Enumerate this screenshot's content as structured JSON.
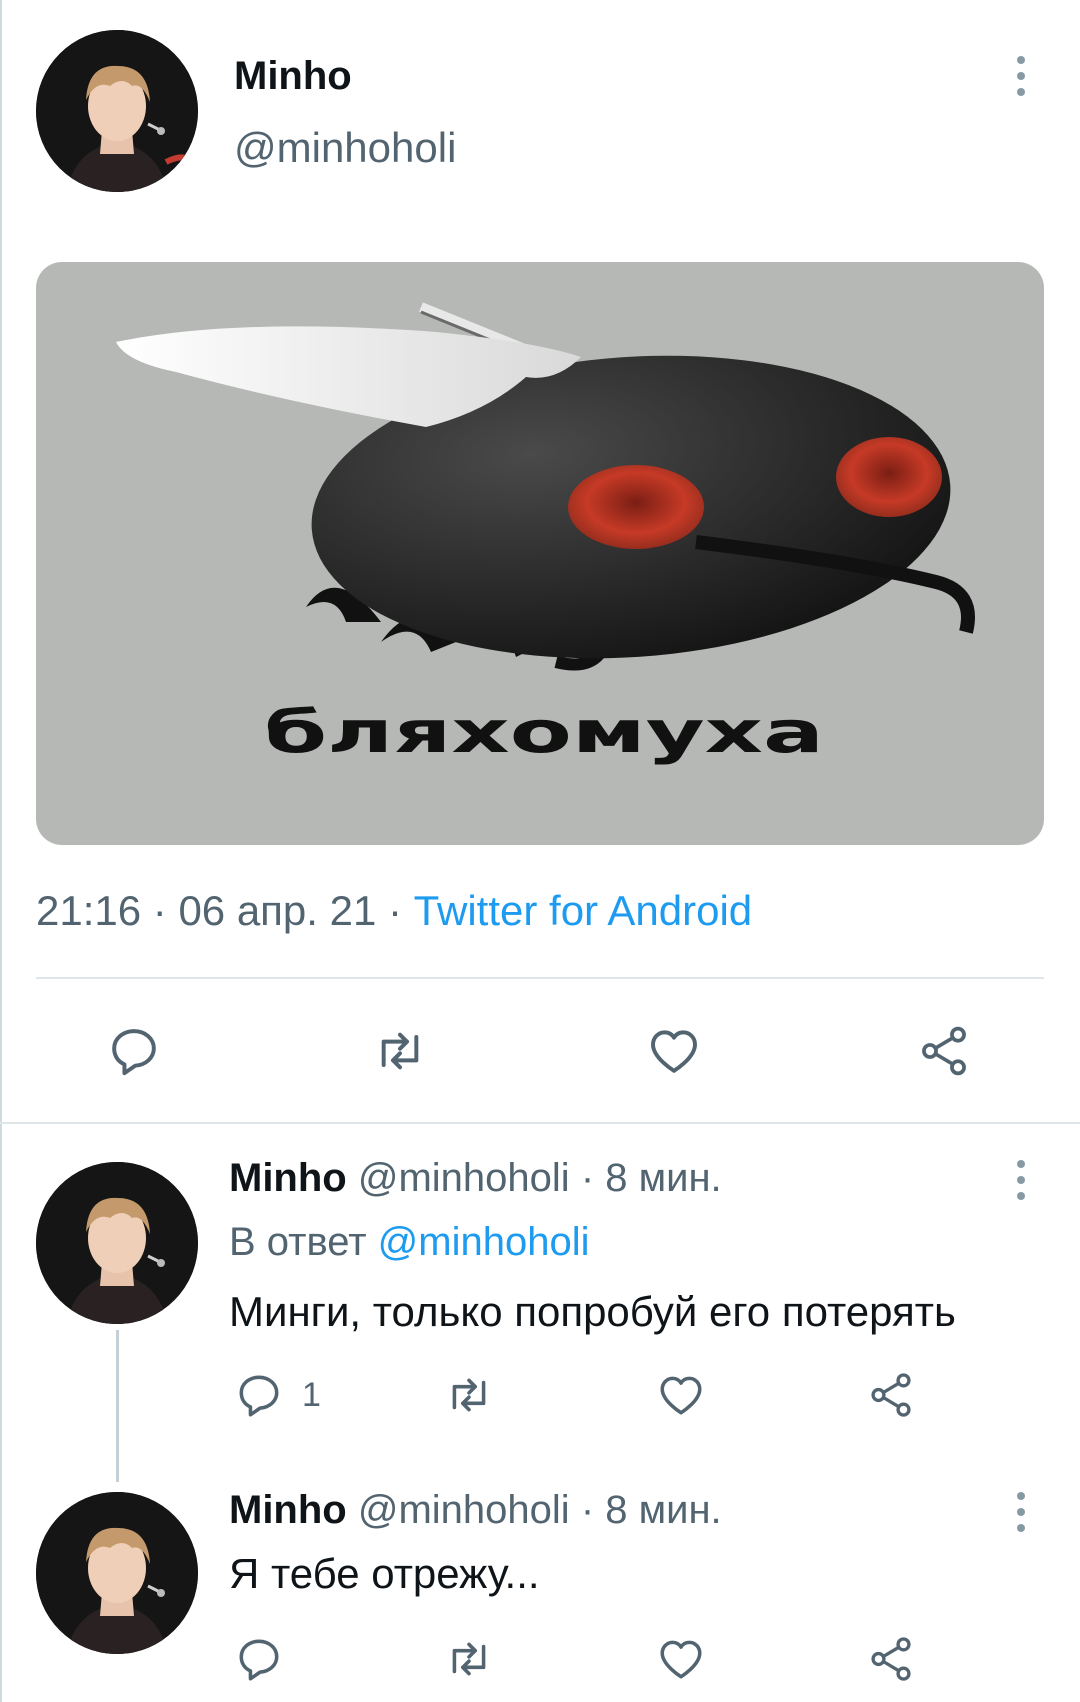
{
  "main_tweet": {
    "author_name": "Minho",
    "author_handle": "@minhoholi",
    "image_caption": "бляхомуха",
    "time": "21:16",
    "separator": " · ",
    "date": "06 апр. 21",
    "source": "Twitter for Android"
  },
  "replies": [
    {
      "author_name": "Minho",
      "author_handle": "@minhoholi",
      "time_ago": "8 мин.",
      "reply_prefix": "В ответ",
      "reply_to": "@minhoholi",
      "text": "Минги, только попробуй его потерять",
      "reply_count": "1"
    },
    {
      "author_name": "Minho",
      "author_handle": "@minhoholi",
      "time_ago": "8 мин.",
      "text": "Я тебе отрежу..."
    }
  ],
  "icons": {
    "reply": "reply-icon",
    "retweet": "retweet-icon",
    "like": "heart-icon",
    "share": "share-icon",
    "more": "more-vertical-icon"
  },
  "colors": {
    "accent": "#1d9bf0",
    "muted": "#536471",
    "text": "#0f1419",
    "icon": "#536471"
  }
}
